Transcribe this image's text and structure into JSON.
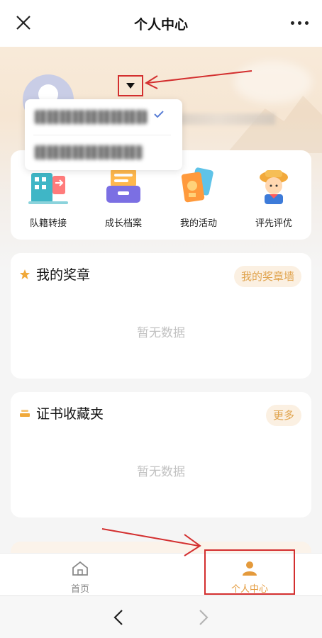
{
  "header": {
    "title": "个人中心"
  },
  "icons": {
    "close": "close-icon",
    "more": "more-icon",
    "dropdown": "caret-down-icon",
    "check": "check-icon"
  },
  "nav": [
    {
      "label": "队籍转接",
      "icon": "building-transfer-icon"
    },
    {
      "label": "成长档案",
      "icon": "archive-box-icon"
    },
    {
      "label": "我的活动",
      "icon": "activity-cards-icon"
    },
    {
      "label": "评先评优",
      "icon": "student-avatar-icon"
    }
  ],
  "medals": {
    "title": "我的奖章",
    "action": "我的奖章墙",
    "empty": "暂无数据"
  },
  "certificates": {
    "title": "证书收藏夹",
    "action": "更多",
    "empty": "暂无数据"
  },
  "tabbar": {
    "home": "首页",
    "me": "个人中心"
  },
  "colors": {
    "accent": "#e49a3c",
    "pill_bg": "#fbf0e2",
    "highlight": "#d32f2f",
    "check": "#5b7fd6"
  }
}
